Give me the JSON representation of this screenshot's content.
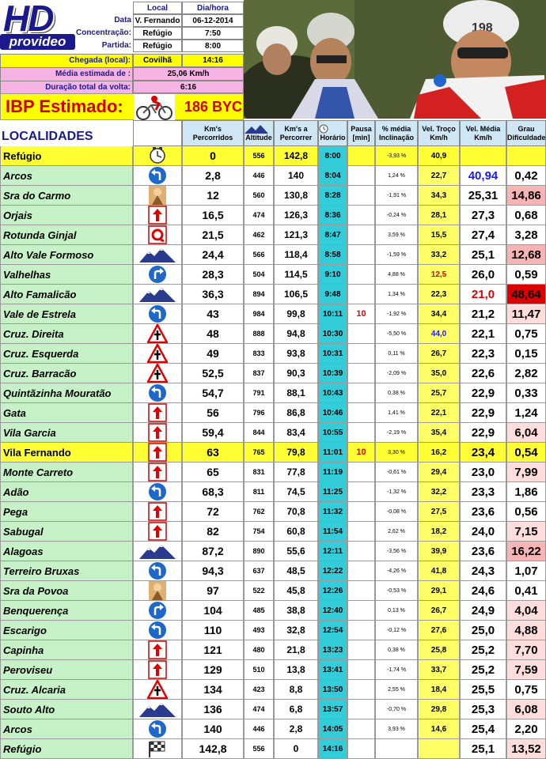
{
  "logo": {
    "hd": "HD",
    "provideo": "provideo"
  },
  "info": {
    "col_local": "Local",
    "col_dia": "Dia/hora",
    "data_label": "Data",
    "data_local": "V. Fernando",
    "data_dia": "06-12-2014",
    "concentracao_label": "Concentração:",
    "concentracao_local": "Refúgio",
    "concentracao_hora": "7:50",
    "partida_label": "Partida:",
    "partida_local": "Refúgio",
    "partida_hora": "8:00",
    "chegada_label": "Chegada (local):",
    "chegada_local": "Covilhã",
    "chegada_hora": "14:16",
    "media_label": "Média estimada de :",
    "media_value": "25,06 Km/h",
    "duracao_label": "Duração total da volta:",
    "duracao_value": "6:16"
  },
  "ibp": {
    "label": "IBP Estimado:",
    "value": "186 BYC",
    "icon": "cyclist-icon"
  },
  "columns": {
    "localidades": "LOCALIDADES",
    "km_perc": [
      "Km's",
      "Percorridos"
    ],
    "altitude": "Altitude",
    "km_a_perc": [
      "Km's a",
      "Percorrer"
    ],
    "horario": "Horário",
    "pausa": [
      "Pausa",
      "[min]"
    ],
    "inclinacao": [
      "% média",
      "Inclinação"
    ],
    "vel_troco": [
      "Vel. Troço",
      "Km/h"
    ],
    "vel_media": [
      "Vel. Média",
      "Km/h"
    ],
    "grau": [
      "Grau",
      "Dificuldade"
    ]
  },
  "colors": {
    "horario": "#33ccd9",
    "names": "#c7f2c7",
    "highlight": "#ffff33",
    "velTroco": "#ffff66"
  },
  "rows": [
    {
      "name": "Refúgio",
      "icon": "clock-icon",
      "km": "0",
      "alt": "556",
      "rem": "142,8",
      "hor": "8:00",
      "pausa": "",
      "inc": "-3,93 %",
      "vt": "40,9",
      "vm": "",
      "df": "",
      "hi": true
    },
    {
      "name": "Arcos",
      "icon": "turn-left-icon",
      "km": "2,8",
      "alt": "446",
      "rem": "140",
      "hor": "8:04",
      "pausa": "",
      "inc": "1,24 %",
      "vt": "22,7",
      "vm": "40,94",
      "df": "0,42",
      "vmc": "blue"
    },
    {
      "name": "Sra do Carmo",
      "icon": "chapel-icon",
      "km": "12",
      "alt": "560",
      "rem": "130,8",
      "hor": "8:28",
      "pausa": "",
      "inc": "-1,91 %",
      "vt": "34,3",
      "vm": "25,31",
      "df": "14,86",
      "dfc": "pink2"
    },
    {
      "name": "Orjais",
      "icon": "straight-arrow-icon",
      "km": "16,5",
      "alt": "474",
      "rem": "126,3",
      "hor": "8:36",
      "pausa": "",
      "inc": "-0,24 %",
      "vt": "28,1",
      "vm": "27,3",
      "df": "0,68"
    },
    {
      "name": "Rotunda Ginjal",
      "icon": "roundabout-icon",
      "km": "21,5",
      "alt": "462",
      "rem": "121,3",
      "hor": "8:47",
      "pausa": "",
      "inc": "3,59 %",
      "vt": "15,5",
      "vm": "27,4",
      "df": "3,28"
    },
    {
      "name": "Alto Vale Formoso",
      "icon": "mountain-icon",
      "km": "24,4",
      "alt": "566",
      "rem": "118,4",
      "hor": "8:58",
      "pausa": "",
      "inc": "-1,59 %",
      "vt": "33,2",
      "vm": "25,1",
      "df": "12,68",
      "dfc": "pink2"
    },
    {
      "name": "Valhelhas",
      "icon": "turn-right-icon",
      "km": "28,3",
      "alt": "504",
      "rem": "114,5",
      "hor": "9:10",
      "pausa": "",
      "inc": "4,88 %",
      "vt": "12,5",
      "vm": "26,0",
      "df": "0,59",
      "vtc": "red"
    },
    {
      "name": "Alto Famalicão",
      "icon": "mountain-icon",
      "km": "36,3",
      "alt": "894",
      "rem": "106,5",
      "hor": "9:48",
      "pausa": "",
      "inc": "1,34 %",
      "vt": "22,3",
      "vm": "21,0",
      "df": "48,64",
      "vmc": "red",
      "dfc": "red"
    },
    {
      "name": "Vale de Estrela",
      "icon": "turn-left-icon",
      "km": "43",
      "alt": "984",
      "rem": "99,8",
      "hor": "10:11",
      "pausa": "10",
      "inc": "-1,92 %",
      "vt": "34,4",
      "vm": "21,2",
      "df": "11,47",
      "dfc": "pink"
    },
    {
      "name": "Cruz. Direita",
      "icon": "crossroads-icon",
      "km": "48",
      "alt": "888",
      "rem": "94,8",
      "hor": "10:30",
      "pausa": "",
      "inc": "-5,50 %",
      "vt": "44,0",
      "vm": "22,1",
      "df": "0,75",
      "vtc": "blue"
    },
    {
      "name": "Cruz. Esquerda",
      "icon": "crossroads-icon",
      "km": "49",
      "alt": "833",
      "rem": "93,8",
      "hor": "10:31",
      "pausa": "",
      "inc": "0,11 %",
      "vt": "26,7",
      "vm": "22,3",
      "df": "0,15"
    },
    {
      "name": "Cruz. Barracão",
      "icon": "crossroads-icon",
      "km": "52,5",
      "alt": "837",
      "rem": "90,3",
      "hor": "10:39",
      "pausa": "",
      "inc": "-2,09 %",
      "vt": "35,0",
      "vm": "22,6",
      "df": "2,82"
    },
    {
      "name": "Quintãzinha Mouratão",
      "icon": "turn-left-icon",
      "km": "54,7",
      "alt": "791",
      "rem": "88,1",
      "hor": "10:43",
      "pausa": "",
      "inc": "0,38 %",
      "vt": "25,7",
      "vm": "22,9",
      "df": "0,33"
    },
    {
      "name": "Gata",
      "icon": "straight-arrow-icon",
      "km": "56",
      "alt": "796",
      "rem": "86,8",
      "hor": "10:46",
      "pausa": "",
      "inc": "1,41 %",
      "vt": "22,1",
      "vm": "22,9",
      "df": "1,24"
    },
    {
      "name": "Vila Garcia",
      "icon": "straight-arrow-icon",
      "km": "59,4",
      "alt": "844",
      "rem": "83,4",
      "hor": "10:55",
      "pausa": "",
      "inc": "-2,19 %",
      "vt": "35,4",
      "vm": "22,9",
      "df": "6,04",
      "dfc": "pink"
    },
    {
      "name": "Vila Fernando",
      "icon": "straight-arrow-icon",
      "km": "63",
      "alt": "765",
      "rem": "79,8",
      "hor": "11:01",
      "pausa": "10",
      "inc": "3,30 %",
      "vt": "16,2",
      "vm": "23,4",
      "df": "0,54",
      "hi": true
    },
    {
      "name": "Monte Carreto",
      "icon": "straight-arrow-icon",
      "km": "65",
      "alt": "831",
      "rem": "77,8",
      "hor": "11:19",
      "pausa": "",
      "inc": "-0,61 %",
      "vt": "29,4",
      "vm": "23,0",
      "df": "7,99",
      "dfc": "pink"
    },
    {
      "name": "Adão",
      "icon": "turn-left-icon",
      "km": "68,3",
      "alt": "811",
      "rem": "74,5",
      "hor": "11:25",
      "pausa": "",
      "inc": "-1,32 %",
      "vt": "32,2",
      "vm": "23,3",
      "df": "1,86"
    },
    {
      "name": "Pega",
      "icon": "straight-arrow-icon",
      "km": "72",
      "alt": "762",
      "rem": "70,8",
      "hor": "11:32",
      "pausa": "",
      "inc": "-0,08 %",
      "vt": "27,5",
      "vm": "23,6",
      "df": "0,56"
    },
    {
      "name": "Sabugal",
      "icon": "straight-arrow-icon",
      "km": "82",
      "alt": "754",
      "rem": "60,8",
      "hor": "11:54",
      "pausa": "",
      "inc": "2,62 %",
      "vt": "18,2",
      "vm": "24,0",
      "df": "7,15",
      "dfc": "pink"
    },
    {
      "name": "Alagoas",
      "icon": "mountain-icon",
      "km": "87,2",
      "alt": "890",
      "rem": "55,6",
      "hor": "12:11",
      "pausa": "",
      "inc": "-3,56 %",
      "vt": "39,9",
      "vm": "23,6",
      "df": "16,22",
      "dfc": "pink2"
    },
    {
      "name": "Terreiro Bruxas",
      "icon": "turn-left-icon",
      "km": "94,3",
      "alt": "637",
      "rem": "48,5",
      "hor": "12:22",
      "pausa": "",
      "inc": "-4,26 %",
      "vt": "41,8",
      "vm": "24,3",
      "df": "1,07"
    },
    {
      "name": "Sra da Povoa",
      "icon": "chapel-icon",
      "km": "97",
      "alt": "522",
      "rem": "45,8",
      "hor": "12:26",
      "pausa": "",
      "inc": "-0,53 %",
      "vt": "29,1",
      "vm": "24,6",
      "df": "0,41"
    },
    {
      "name": "Benquerença",
      "icon": "turn-right-icon",
      "km": "104",
      "alt": "485",
      "rem": "38,8",
      "hor": "12:40",
      "pausa": "",
      "inc": "0,13 %",
      "vt": "26,7",
      "vm": "24,9",
      "df": "4,04",
      "dfc": "pink"
    },
    {
      "name": "Escarigo",
      "icon": "turn-left-icon",
      "km": "110",
      "alt": "493",
      "rem": "32,8",
      "hor": "12:54",
      "pausa": "",
      "inc": "-0,12 %",
      "vt": "27,6",
      "vm": "25,0",
      "df": "4,88",
      "dfc": "pink"
    },
    {
      "name": "Capinha",
      "icon": "straight-arrow-icon",
      "km": "121",
      "alt": "480",
      "rem": "21,8",
      "hor": "13:23",
      "pausa": "",
      "inc": "0,38 %",
      "vt": "25,8",
      "vm": "25,2",
      "df": "7,70",
      "dfc": "pink"
    },
    {
      "name": "Peroviseu",
      "icon": "straight-arrow-icon",
      "km": "129",
      "alt": "510",
      "rem": "13,8",
      "hor": "13:41",
      "pausa": "",
      "inc": "-1,74 %",
      "vt": "33,7",
      "vm": "25,2",
      "df": "7,59",
      "dfc": "pink"
    },
    {
      "name": "Cruz. Alcaria",
      "icon": "crossroads-icon",
      "km": "134",
      "alt": "423",
      "rem": "8,8",
      "hor": "13:50",
      "pausa": "",
      "inc": "2,55 %",
      "vt": "18,4",
      "vm": "25,5",
      "df": "0,75"
    },
    {
      "name": "Souto Alto",
      "icon": "mountain-icon",
      "km": "136",
      "alt": "474",
      "rem": "6,8",
      "hor": "13:57",
      "pausa": "",
      "inc": "-0,70 %",
      "vt": "29,8",
      "vm": "25,3",
      "df": "6,08",
      "dfc": "pink"
    },
    {
      "name": "Arcos",
      "icon": "turn-left-icon",
      "km": "140",
      "alt": "446",
      "rem": "2,8",
      "hor": "14:05",
      "pausa": "",
      "inc": "3,93 %",
      "vt": "14,6",
      "vm": "25,4",
      "df": "2,20"
    },
    {
      "name": "Refúgio",
      "icon": "checkered-flag-icon",
      "km": "142,8",
      "alt": "556",
      "rem": "0",
      "hor": "14:16",
      "pausa": "",
      "inc": "",
      "vt": "",
      "vm": "25,1",
      "df": "13,52",
      "dfc": "pink"
    }
  ]
}
